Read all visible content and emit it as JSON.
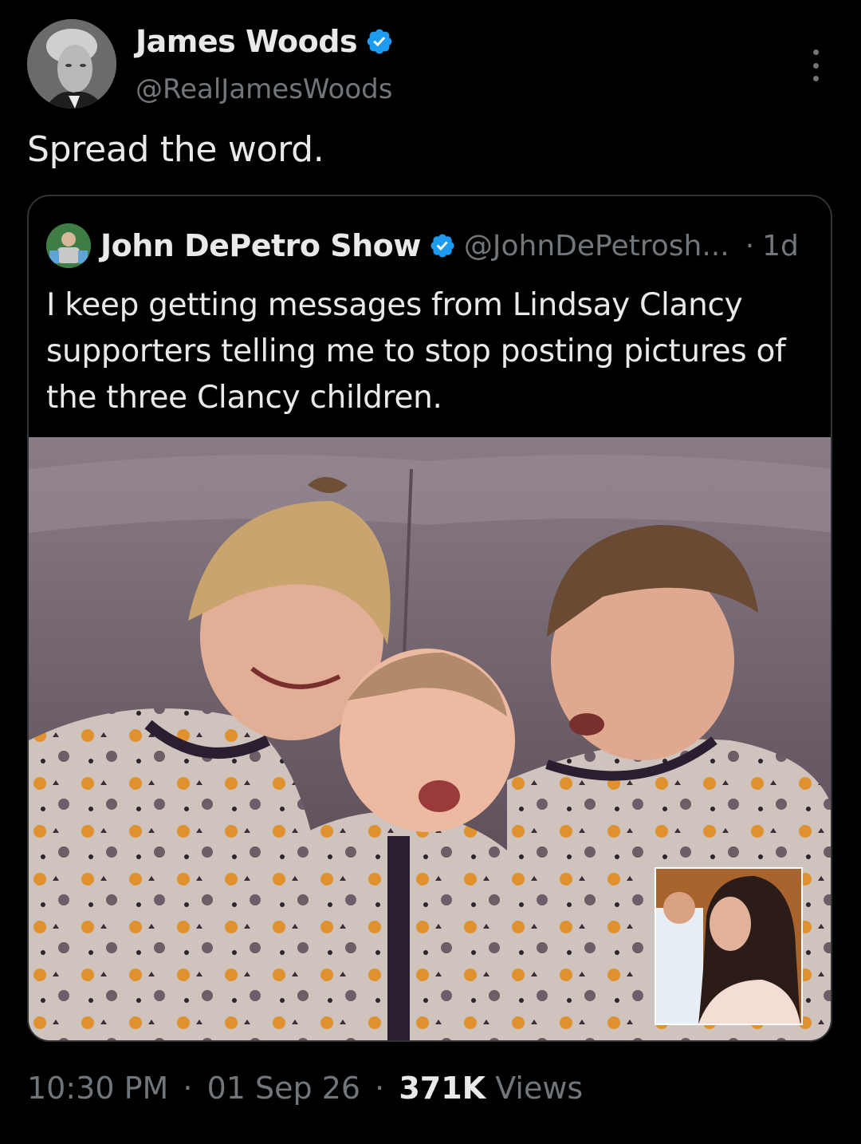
{
  "tweet": {
    "author": {
      "name": "James Woods",
      "handle": "@RealJamesWoods",
      "verified": true,
      "avatar_icon": "profile-photo-avatar"
    },
    "text": "Spread the word.",
    "more_icon": "more-options-icon"
  },
  "quoted_tweet": {
    "author": {
      "name": "John DePetro Show",
      "handle": "@JohnDePetrosh...",
      "verified": true
    },
    "dot": "·",
    "time": "1d",
    "text": "I keep getting messages from Lindsay Clancy supporters telling me to stop posting pictures of the three Clancy children.",
    "image": {
      "description_icon": "photo-three-children-icon",
      "inset_icon": "inset-woman-photo-icon"
    }
  },
  "footer": {
    "time": "10:30 PM",
    "sep1": "·",
    "date": "01 Sep 26",
    "sep2": "·",
    "views_count": "371K",
    "views_label": "Views"
  },
  "colors": {
    "background": "#000000",
    "text": "#e7e9ea",
    "muted": "#71767b",
    "verified_blue": "#1d9bf0",
    "border": "#2f3336"
  }
}
